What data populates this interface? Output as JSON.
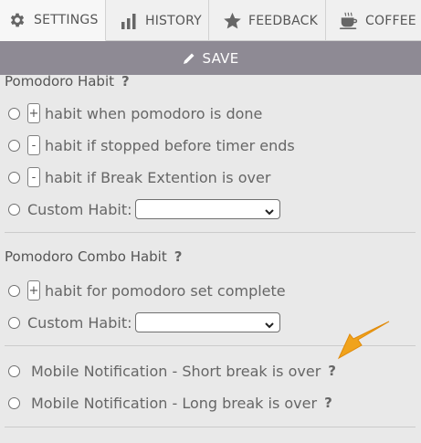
{
  "tabs": [
    {
      "label": "SETTINGS",
      "icon": "gear-icon",
      "active": true
    },
    {
      "label": "HISTORY",
      "icon": "bar-chart-icon",
      "active": false
    },
    {
      "label": "FEEDBACK",
      "icon": "star-icon",
      "active": false
    },
    {
      "label": "COFFEE",
      "icon": "coffee-cup-icon",
      "active": false
    }
  ],
  "save": {
    "label": "SAVE",
    "icon": "pencil-icon"
  },
  "sections": {
    "pomodoro_habit": {
      "title": "Pomodoro Habit",
      "help": "?",
      "options": [
        {
          "sign": "+",
          "text": "habit when pomodoro is done"
        },
        {
          "sign": "-",
          "text": "habit if stopped before timer ends"
        },
        {
          "sign": "-",
          "text": "habit if Break Extention is over"
        }
      ],
      "custom_label": "Custom Habit:",
      "custom_value": ""
    },
    "combo_habit": {
      "title": "Pomodoro Combo Habit",
      "help": "?",
      "options": [
        {
          "sign": "+",
          "text": "habit for pomodoro set complete"
        }
      ],
      "custom_label": "Custom Habit:",
      "custom_value": ""
    },
    "notifications": {
      "options": [
        {
          "text": "Mobile Notification - Short break is over",
          "help": "?"
        },
        {
          "text": "Mobile Notification - Long break is over",
          "help": "?"
        }
      ]
    }
  },
  "colors": {
    "save_bar": "#8e8a94",
    "background": "#e9e9e9",
    "arrow": "#f0a31c"
  }
}
